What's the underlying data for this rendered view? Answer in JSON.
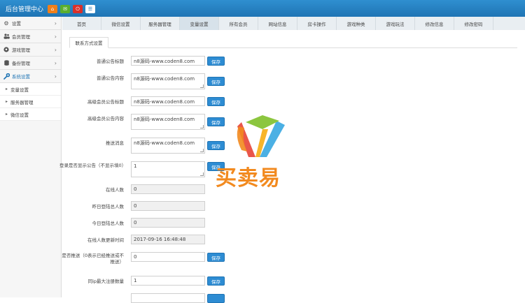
{
  "header": {
    "title": "后台管理中心"
  },
  "sidebar": {
    "items": [
      {
        "label": "设置",
        "icon": "gears-icon",
        "glyph": "⚙"
      },
      {
        "label": "会员管理",
        "icon": "users-icon",
        "glyph": "👥"
      },
      {
        "label": "游戏管理",
        "icon": "football-icon",
        "glyph": "⚽"
      },
      {
        "label": "备份管理",
        "icon": "database-icon",
        "glyph": "▤"
      },
      {
        "label": "系统设置",
        "icon": "wrench-icon",
        "glyph": "✎"
      }
    ],
    "subitems": [
      {
        "label": "变量设置"
      },
      {
        "label": "服务器管理"
      },
      {
        "label": "微信设置"
      }
    ]
  },
  "tabs": [
    {
      "label": "首页"
    },
    {
      "label": "微信设置"
    },
    {
      "label": "服务器管理"
    },
    {
      "label": "变量设置"
    },
    {
      "label": "所有会员"
    },
    {
      "label": "网站信息"
    },
    {
      "label": "房卡操作"
    },
    {
      "label": "游戏种类"
    },
    {
      "label": "游戏玩法"
    },
    {
      "label": "修改信息"
    },
    {
      "label": "修改密码"
    }
  ],
  "content": {
    "subtab": "联系方式设置",
    "save_label": "保存",
    "rows": [
      {
        "label": "普通公告标题",
        "value": "n8源码-www.coden8.com"
      },
      {
        "label": "普通公告内容",
        "value": "n8源码-www.coden8.com"
      },
      {
        "label": "高级会员公告标题",
        "value": "n8源码-www.coden8.com"
      },
      {
        "label": "高级会员公告内容",
        "value": "n8源码-www.coden8.com"
      },
      {
        "label": "推送消息",
        "value": "n8源码-www.coden8.com"
      },
      {
        "label": "登录是否显示公告（不显示填0）",
        "value": "1"
      },
      {
        "label": "在线人数",
        "value": "0"
      },
      {
        "label": "昨日登陆总人数",
        "value": "0"
      },
      {
        "label": "今日登陆总人数",
        "value": "0"
      },
      {
        "label": "在线人数更新时间",
        "value": "2017-09-16 16:48:48"
      },
      {
        "label": "是否推送（0表示已经推送或不推送）",
        "value": "0"
      },
      {
        "label": "同ip最大注册数量",
        "value": "1"
      }
    ]
  },
  "watermark": {
    "text": "买卖易"
  },
  "colors": {
    "header": "#1f74b4",
    "accent": "#2d8cd3",
    "logo_orange": "#f28a1f"
  }
}
